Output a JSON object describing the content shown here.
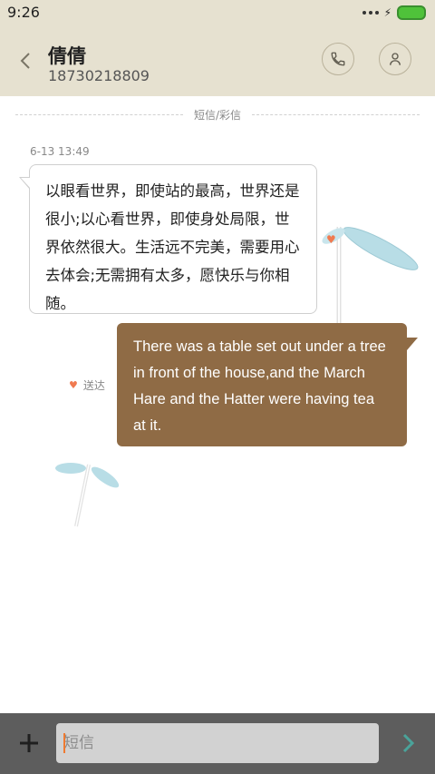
{
  "status_bar": {
    "time": "9:26"
  },
  "header": {
    "contact_name": "倩倩",
    "phone_number": "18730218809"
  },
  "thread": {
    "divider_label": "短信/彩信",
    "timestamp": "6-13 13:49",
    "incoming_message": "以眼看世界，即使站的最高，世界还是很小;以心看世界，即使身处局限，世界依然很大。生活远不完美，需要用心去体会;无需拥有太多，愿快乐与你相随。",
    "outgoing_message": "There was a table set out under a tree in front of the house,and the March Hare and the Hatter were having tea at it.",
    "delivery_status": "送达"
  },
  "composer": {
    "placeholder": "短信"
  },
  "colors": {
    "header_bg": "#e6e1d0",
    "outgoing_bubble": "#8f6b45",
    "footer_bg": "#5d5d5d",
    "send_accent": "#4aa39a",
    "heart": "#f07a50"
  },
  "icons": {
    "back": "chevron-left-icon",
    "call": "phone-icon",
    "contact": "person-icon",
    "attach": "plus-icon",
    "send": "chevron-right-icon",
    "status": "heart-icon"
  }
}
